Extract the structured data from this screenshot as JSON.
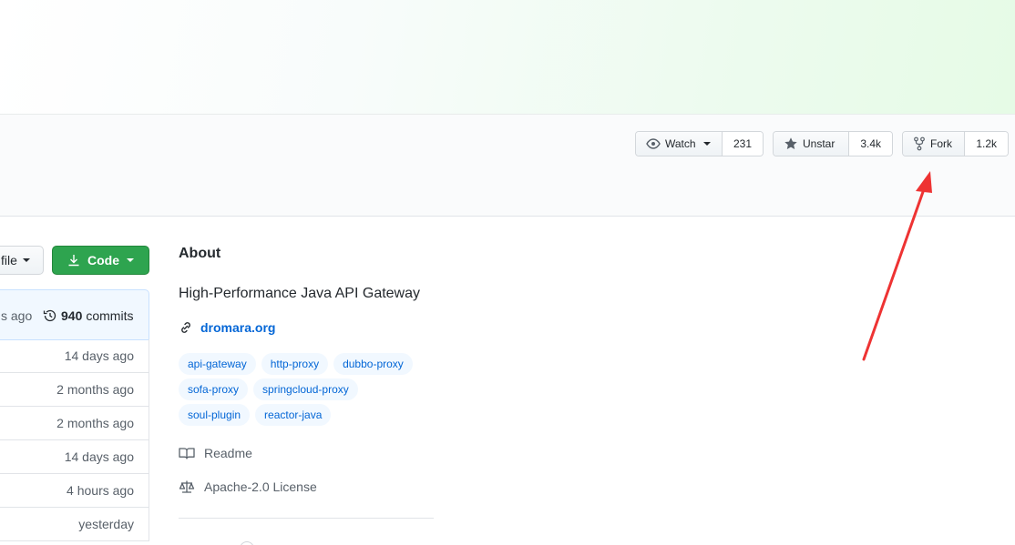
{
  "header": {
    "watch": {
      "label": "Watch",
      "count": "231"
    },
    "star": {
      "label": "Unstar",
      "count": "3.4k"
    },
    "fork": {
      "label": "Fork",
      "count": "1.2k"
    }
  },
  "toolbar": {
    "file_label": "file",
    "code_label": "Code"
  },
  "commit_bar": {
    "ago": "s ago",
    "commit_count": "940",
    "commit_label": "commits"
  },
  "files": [
    {
      "age": "14 days ago"
    },
    {
      "age": "2 months ago"
    },
    {
      "age": "2 months ago"
    },
    {
      "age": "14 days ago"
    },
    {
      "age": "4 hours ago"
    },
    {
      "age": "yesterday"
    }
  ],
  "about": {
    "title": "About",
    "description": "High-Performance Java API Gateway",
    "website": "dromara.org",
    "topics": [
      [
        "api-gateway",
        "http-proxy",
        "dubbo-proxy"
      ],
      [
        "sofa-proxy",
        "springcloud-proxy"
      ],
      [
        "soul-plugin",
        "reactor-java"
      ]
    ],
    "readme_label": "Readme",
    "license_label": "Apache-2.0 License"
  },
  "colors": {
    "accent_green": "#2ea44f",
    "link_blue": "#0366d6",
    "annotation_red": "#ee3333"
  }
}
